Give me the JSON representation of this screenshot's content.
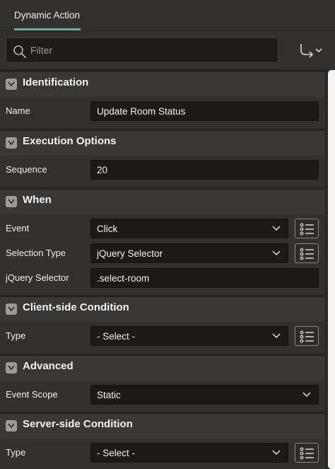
{
  "tabs": {
    "active_label": "Dynamic Action"
  },
  "toolbar": {
    "filter_placeholder": "Filter",
    "search_icon": "search-icon",
    "goto_icon": "goto-arrow-icon"
  },
  "sections": {
    "identification": {
      "title": "Identification",
      "name_label": "Name",
      "name_value": "Update Room Status"
    },
    "execution": {
      "title": "Execution Options",
      "sequence_label": "Sequence",
      "sequence_value": "20"
    },
    "when": {
      "title": "When",
      "event_label": "Event",
      "event_value": "Click",
      "selection_type_label": "Selection Type",
      "selection_type_value": "jQuery Selector",
      "jquery_selector_label": "jQuery Selector",
      "jquery_selector_value": ".select-room"
    },
    "client_condition": {
      "title": "Client-side Condition",
      "type_label": "Type",
      "type_value": "- Select -"
    },
    "advanced": {
      "title": "Advanced",
      "event_scope_label": "Event Scope",
      "event_scope_value": "Static"
    },
    "server_condition": {
      "title": "Server-side Condition",
      "type_label": "Type",
      "type_value": "- Select -"
    }
  },
  "colors": {
    "background": "#33302d",
    "header": "#3a3735",
    "field": "#1b1a19",
    "accent_underline": "#7ba89a"
  }
}
